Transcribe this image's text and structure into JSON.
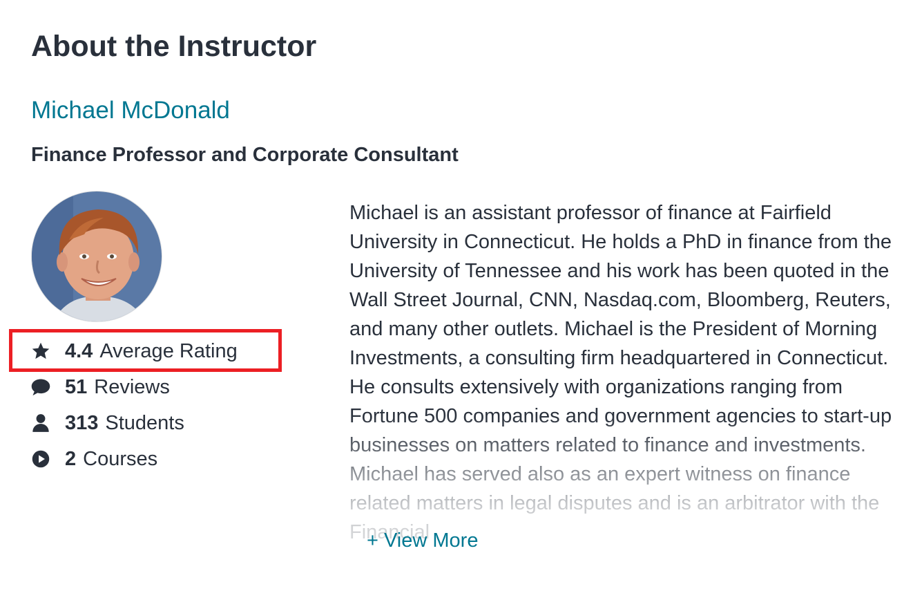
{
  "section": {
    "title": "About the Instructor"
  },
  "instructor": {
    "name": "Michael McDonald",
    "headline": "Finance Professor and Corporate Consultant",
    "avatar": "instructor-avatar-photo"
  },
  "stats": [
    {
      "icon": "star-icon",
      "value": "4.4",
      "label": "Average Rating"
    },
    {
      "icon": "comment-icon",
      "value": "51",
      "label": "Reviews"
    },
    {
      "icon": "user-icon",
      "value": "313",
      "label": "Students"
    },
    {
      "icon": "play-circle-icon",
      "value": "2",
      "label": "Courses"
    }
  ],
  "highlight": {
    "color": "#ec1f24"
  },
  "bio": {
    "text": "Michael is an assistant professor of finance at Fairfield University in Connecticut. He holds a PhD in finance from the University of Tennessee and his work has been quoted in the Wall Street Journal, CNN, Nasdaq.com, Bloomberg, Reuters, and many other outlets. Michael is the President of Morning Investments, a consulting firm headquartered in Connecticut. He consults extensively with organizations ranging from Fortune 500 companies and government agencies to start-up businesses on matters related to finance and investments. Michael has served also as an expert witness on finance related matters in legal disputes and is an arbitrator with the Financial",
    "view_more_label": "+ View More"
  },
  "colors": {
    "link": "#007791",
    "text": "#29303b"
  }
}
